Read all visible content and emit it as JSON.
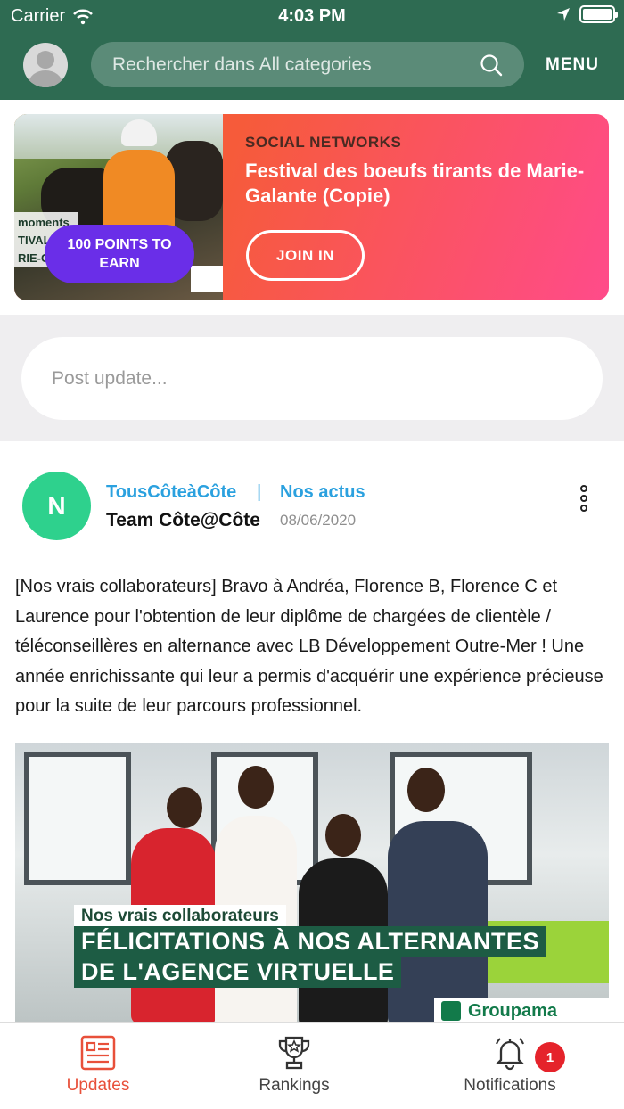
{
  "status_bar": {
    "carrier": "Carrier",
    "time": "4:03 PM"
  },
  "header": {
    "search_placeholder": "Rechercher dans All categories",
    "menu_label": "MENU"
  },
  "promo": {
    "points_badge": "100 POINTS TO EARN",
    "category": "SOCIAL NETWORKS",
    "title": "Festival des boeufs tirants de Marie-Galante (Copie)",
    "join_label": "JOIN IN",
    "image_caption": "moments TIVAL D RIE-G"
  },
  "compose": {
    "placeholder": "Post update..."
  },
  "post": {
    "avatar_initial": "N",
    "group": "TousCôteàCôte",
    "separator": "|",
    "category": "Nos actus",
    "author": "Team Côte@Côte",
    "date": "08/06/2020",
    "text": "[Nos vrais collaborateurs] Bravo à Andréa, Florence B, Florence C et Laurence pour l'obtention de leur diplôme de chargées de clientèle / téléconseillères en alternance avec LB Développement Outre-Mer ! Une année enrichissante qui leur a permis d'acquérir une expérience précieuse pour la suite de leur parcours professionnel.",
    "image": {
      "tagline": "Nos vrais collaborateurs",
      "banner_line1": "FÉLICITATIONS À NOS ALTERNANTES",
      "banner_line2": "DE L'AGENCE VIRTUELLE",
      "logo_text": "Groupama"
    }
  },
  "tabs": [
    {
      "label": "Updates",
      "icon": "updates-icon",
      "active": true
    },
    {
      "label": "Rankings",
      "icon": "trophy-icon",
      "active": false
    },
    {
      "label": "Notifications",
      "icon": "bell-icon",
      "active": false,
      "badge": "1"
    }
  ],
  "colors": {
    "header_green": "#2e6b52",
    "accent_orange": "#e8503a",
    "link_blue": "#2ba1df",
    "avatar_green": "#2ed18d",
    "badge_purple": "#6a2ee8",
    "notif_red": "#e5232b"
  }
}
